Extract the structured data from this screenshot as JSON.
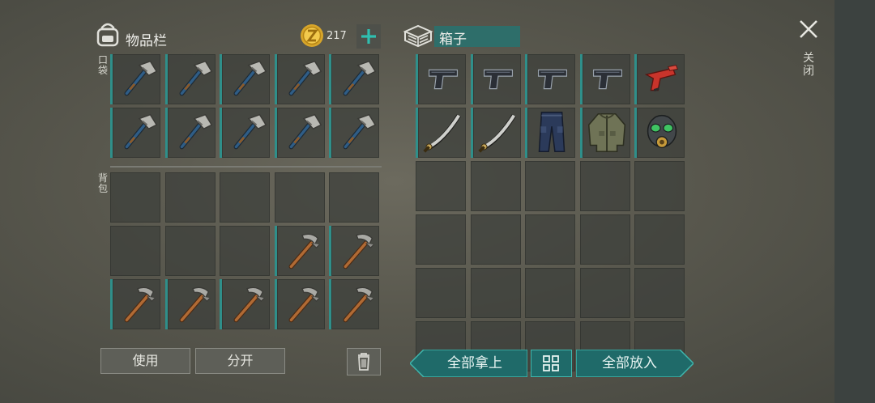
{
  "inventory": {
    "title": "物品栏",
    "coins": "217",
    "pocket_label": "口袋",
    "backpack_label": "背包"
  },
  "box": {
    "title": "箱子"
  },
  "close": {
    "label": "关闭"
  },
  "buttons": {
    "use": "使用",
    "split": "分开",
    "take_all": "全部拿上",
    "put_all": "全部放入"
  },
  "colors": {
    "accent": "#2f8f8a",
    "panel_slot": "#3c3e3a",
    "button_teal": "#1f6a69"
  },
  "pocket_slots": [
    "hatchet",
    "hatchet",
    "hatchet",
    "hatchet",
    "hatchet",
    "hatchet",
    "hatchet",
    "hatchet",
    "hatchet",
    "hatchet"
  ],
  "backpack_slots": [
    "",
    "",
    "",
    "",
    "",
    "",
    "",
    "",
    "pickaxe",
    "pickaxe",
    "pickaxe",
    "pickaxe",
    "pickaxe",
    "pickaxe",
    "pickaxe"
  ],
  "box_slots": [
    "pistol",
    "pistol",
    "pistol",
    "pistol",
    "flare-gun",
    "machete",
    "machete",
    "pants",
    "jacket",
    "gas-mask",
    "",
    "",
    "",
    "",
    "",
    "",
    "",
    "",
    "",
    "",
    "",
    "",
    "",
    "",
    "",
    "",
    "",
    "",
    "",
    ""
  ]
}
